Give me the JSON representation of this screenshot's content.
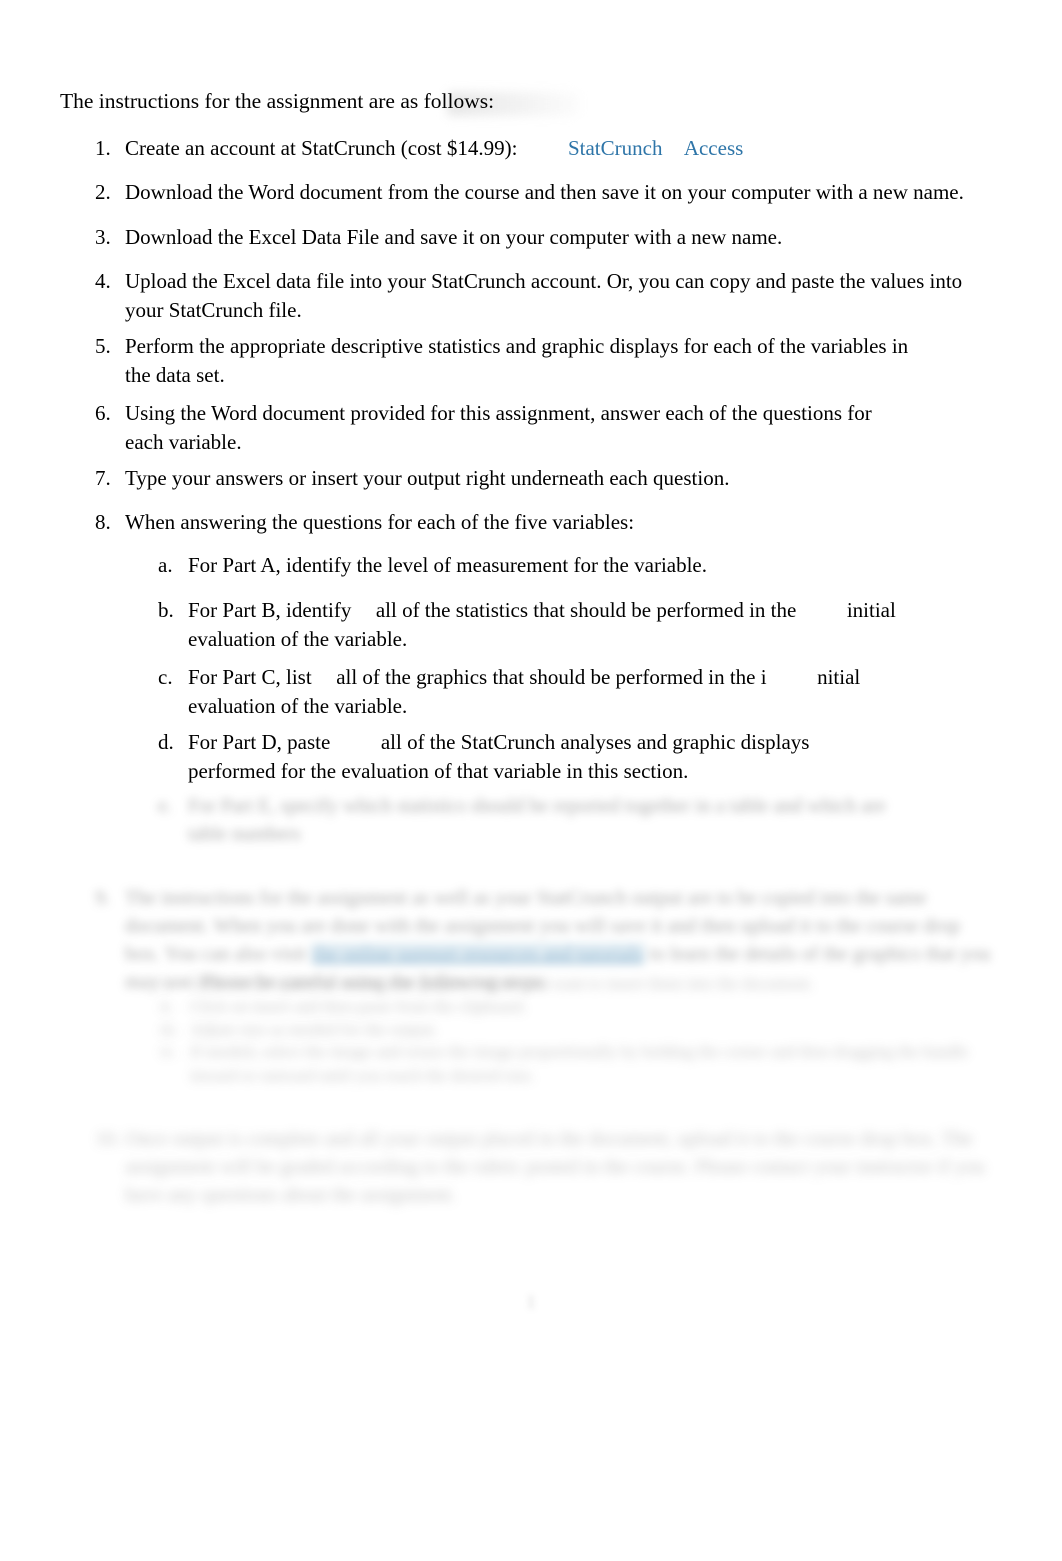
{
  "document": {
    "heading": "The instructions for the assignment are as follows:",
    "page_number": "1",
    "colors": {
      "link": "#2e75a8",
      "highlight": "#c4dbe8",
      "text": "#000000"
    }
  },
  "instructions": [
    {
      "marker": "1.",
      "text": "Create an account at StatCrunch (cost $14.99):",
      "link_primary": "StatCrunch",
      "link_secondary": "Access"
    },
    {
      "marker": "2.",
      "text": "Download the Word document from the course and then save it on your computer with a new name."
    },
    {
      "marker": "3.",
      "text": "Download the Excel Data File and save it on your computer with a new name."
    },
    {
      "marker": "4.",
      "text": "Upload the Excel data file into your StatCrunch account. Or, you can copy and paste the values into your StatCrunch file."
    },
    {
      "marker": "5.",
      "text": "Perform the appropriate descriptive statistics and graphic displays for each of the variables in the data set."
    },
    {
      "marker": "6.",
      "text": "Using the Word document provided for this assignment, answer each of the questions for each variable."
    },
    {
      "marker": "7.",
      "text": "Type your answers or insert your output right underneath each question."
    },
    {
      "marker": "8.",
      "text": "When answering the questions for each of the five variables:"
    }
  ],
  "subitems": [
    {
      "marker": "a.",
      "part1": "For Part A, identify the level of measurement for the variable.",
      "part2": "",
      "part3": ""
    },
    {
      "marker": "b.",
      "part1": "For Part B, identify",
      "part2": "all of the statistics that should be performed in the",
      "part3": "initial evaluation of the variable."
    },
    {
      "marker": "c.",
      "part1": "For Part C, list",
      "part2": "all of the graphics that should be performed in the i",
      "part3": "nitial evaluation of the variable."
    },
    {
      "marker": "d.",
      "part1": "For Part D, paste",
      "part2": "all of the StatCrunch analyses and graphic displays performed for the evaluation of that variable in this section.",
      "part3": ""
    }
  ],
  "redacted": {
    "note": "blurred-illegible",
    "subitem_e": {
      "marker": "e.",
      "line1": "For Part E, specify which statistics should be reported together in a table and which",
      "line2": "are table numbers"
    },
    "item9": {
      "marker": "9.",
      "line1": "The instructions for the assignment as well as your StatCrunch output are to be copied into the same document.",
      "line2": "When you are done with the assignment you will save it and then upload it to the course drop box.",
      "line3_pre": "You can also visit",
      "line3_link": "the online support resources and tutorials",
      "line3_post": "to learn the details of the graphics that you may use.",
      "line4": "Please be careful using the following steps:"
    },
    "item9_sublist": [
      {
        "marker": "i.",
        "text": "There is the option to resize your graphics when you want to insert them into the document."
      },
      {
        "marker": "ii.",
        "text": "Click on insert and then paste from the clipboard."
      },
      {
        "marker": "iii.",
        "text": "Adjust size as needed for the output."
      },
      {
        "marker": "iv.",
        "text": "If needed, select the image and resize the image proportionally by holding the corner and then dragging the handle inward or outward until you reach the desired size."
      }
    ],
    "item10": {
      "marker": "10.",
      "line1": "Once output is complete and all your output placed in the document, upload it to the course drop box.",
      "line2": "The assignment will be graded according to the rubric posted in the course.",
      "line3": "Please contact your instructor if you have any questions about the assignment."
    }
  }
}
